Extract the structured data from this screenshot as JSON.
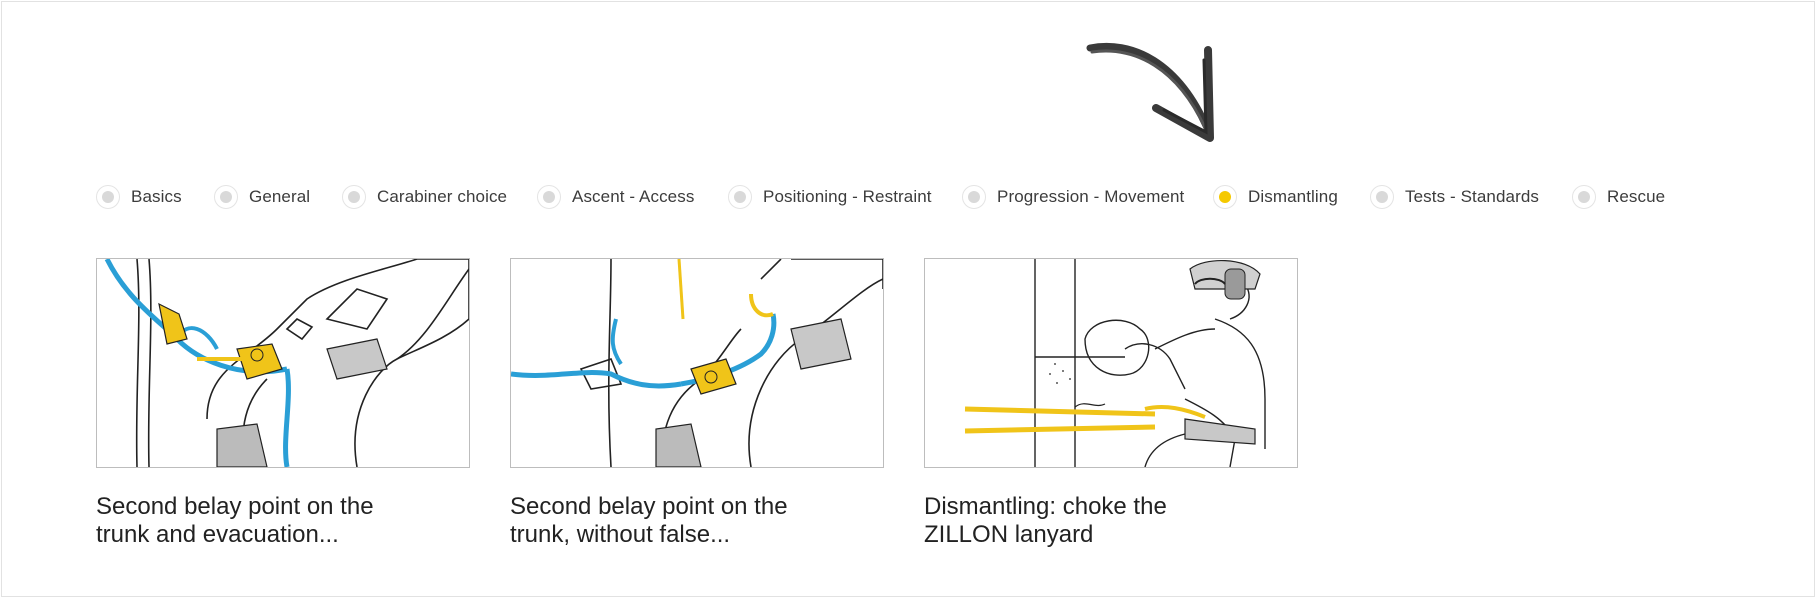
{
  "filters": [
    {
      "label": "Basics",
      "active": false
    },
    {
      "label": "General",
      "active": false
    },
    {
      "label": "Carabiner choice",
      "active": false
    },
    {
      "label": "Ascent - Access",
      "active": false
    },
    {
      "label": "Positioning - Restraint",
      "active": false
    },
    {
      "label": "Progression - Movement",
      "active": false
    },
    {
      "label": "Dismantling",
      "active": true
    },
    {
      "label": "Tests - Standards",
      "active": false
    },
    {
      "label": "Rescue",
      "active": false
    }
  ],
  "cards": [
    {
      "caption_line1": "Second belay point on the",
      "caption_line2": "trunk and evacuation..."
    },
    {
      "caption_line1": "Second belay point on the",
      "caption_line2": "trunk, without false..."
    },
    {
      "caption_line1": "Dismantling: choke the",
      "caption_line2": "ZILLON lanyard"
    }
  ],
  "colors": {
    "accent": "#f5c900",
    "radio_inactive": "#d9d9d9",
    "rope_blue": "#2a9fd6",
    "rope_yellow": "#f0c419",
    "border": "#bdbdbd"
  },
  "icons": {
    "pointer": "hand-drawn-arrow-icon",
    "radio": "radio-dot-icon"
  }
}
